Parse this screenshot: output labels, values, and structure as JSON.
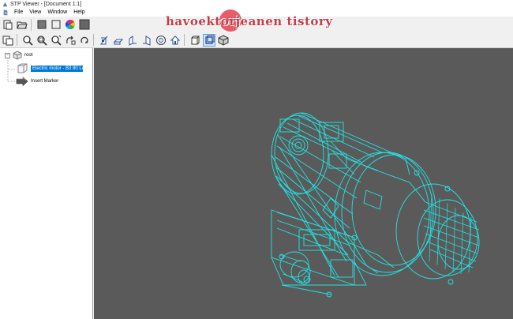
{
  "window": {
    "title": "STP Viewer - [Document 1:1]"
  },
  "menu": [
    "File",
    "View",
    "Window",
    "Help"
  ],
  "toolbar_row1": [
    "paste-icon",
    "open-folder-icon",
    "solid-box-icon",
    "wire-box-icon",
    "color-wheel-icon",
    "dark-box-icon"
  ],
  "toolbar_row2_left": [
    "select-icon",
    "zoom-icon",
    "zoom-window-icon",
    "zoom-fit-icon",
    "pan-icon",
    "rotate-icon"
  ],
  "toolbar_row2_views": [
    "view-front-icon",
    "view-top-icon",
    "view-left-icon",
    "view-right-icon",
    "view-iso-icon",
    "view-home-icon"
  ],
  "toolbar_row2_shading": [
    "shade-flat-icon",
    "shade-wire-icon",
    "shade-hidden-icon"
  ],
  "tree": {
    "root": "root",
    "items": [
      "Electric motor - B3 80 Le",
      "Insert Marker"
    ]
  },
  "watermark": "havoektorjeanen tistory",
  "colors": {
    "viewport_bg": "#5a5a5a",
    "wireframe": "#22e4e4",
    "selection": "#0078d7",
    "watermark": "#c43c4a"
  }
}
